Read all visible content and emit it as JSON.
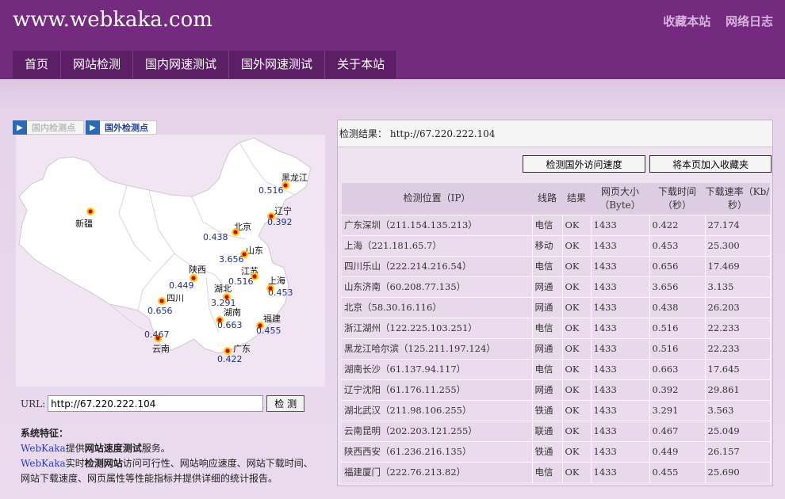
{
  "site": {
    "logo": "www.webkaka.com",
    "top_links": [
      "收藏本站",
      "网络日志"
    ],
    "nav": [
      "首页",
      "网站检测",
      "国内网速测试",
      "国外网速测试",
      "关于本站"
    ]
  },
  "map": {
    "tabs": [
      "国内检测点",
      "国外检测点"
    ],
    "points": [
      {
        "name": "黑龙江",
        "value": "0.516"
      },
      {
        "name": "新疆",
        "value": ""
      },
      {
        "name": "辽宁",
        "value": "0.392"
      },
      {
        "name": "北京",
        "value": "0.438"
      },
      {
        "name": "山东",
        "value": "3.656"
      },
      {
        "name": "江苏",
        "value": "0.516"
      },
      {
        "name": "陕西",
        "value": "0.449"
      },
      {
        "name": "上海",
        "value": "0.453"
      },
      {
        "name": "湖北",
        "value": "3.291"
      },
      {
        "name": "四川",
        "value": "0.656"
      },
      {
        "name": "湖南",
        "value": "0.663"
      },
      {
        "name": "福建",
        "value": "0.455"
      },
      {
        "name": "云南",
        "value": "0.467"
      },
      {
        "name": "广东",
        "value": "0.422"
      }
    ]
  },
  "form": {
    "url_label": "URL:",
    "url_value": "http://67.220.222.104",
    "check_button": "检 测"
  },
  "features": {
    "title": "系统特征：",
    "line1_brand": "WebKaka",
    "line1_pre": "提供",
    "line1_bold": "网站速度测试",
    "line1_post": "服务。",
    "line2_brand": "WebKaka",
    "line2_pre": "实时",
    "line2_bold": "检测网站",
    "line2_post": "访问可行性、网站响应速度、网站下载时间、网站下载速度、网页属性等性能指标并提供详细的统计报告。"
  },
  "results": {
    "label": "检测结果：",
    "url": "http://67.220.222.104",
    "button_foreign": "检测国外访问速度",
    "button_bookmark": "将本页加入收藏夹",
    "columns": [
      "检测位置（IP）",
      "线路",
      "结果",
      "网页大小（Byte）",
      "下载时间（秒）",
      "下载速率（Kb/秒）"
    ],
    "rows": [
      {
        "location": "广东深圳（211.154.135.213）",
        "line": "电信",
        "result": "OK",
        "size": "1433",
        "time": "0.422",
        "rate": "27.174"
      },
      {
        "location": "上海（221.181.65.7）",
        "line": "移动",
        "result": "OK",
        "size": "1433",
        "time": "0.453",
        "rate": "25.300"
      },
      {
        "location": "四川乐山（222.214.216.54）",
        "line": "电信",
        "result": "OK",
        "size": "1433",
        "time": "0.656",
        "rate": "17.469"
      },
      {
        "location": "山东济南（60.208.77.135）",
        "line": "网通",
        "result": "OK",
        "size": "1433",
        "time": "3.656",
        "rate": "3.135"
      },
      {
        "location": "北京（58.30.16.116）",
        "line": "网通",
        "result": "OK",
        "size": "1433",
        "time": "0.438",
        "rate": "26.203"
      },
      {
        "location": "浙江湖州（122.225.103.251）",
        "line": "电信",
        "result": "OK",
        "size": "1433",
        "time": "0.516",
        "rate": "22.233"
      },
      {
        "location": "黑龙江哈尔滨（125.211.197.124）",
        "line": "网通",
        "result": "OK",
        "size": "1433",
        "time": "0.516",
        "rate": "22.233"
      },
      {
        "location": "湖南长沙（61.137.94.117）",
        "line": "电信",
        "result": "OK",
        "size": "1433",
        "time": "0.663",
        "rate": "17.645"
      },
      {
        "location": "辽宁沈阳（61.176.11.255）",
        "line": "网通",
        "result": "OK",
        "size": "1433",
        "time": "0.392",
        "rate": "29.861"
      },
      {
        "location": "湖北武汉（211.98.106.255）",
        "line": "铁通",
        "result": "OK",
        "size": "1433",
        "time": "3.291",
        "rate": "3.563"
      },
      {
        "location": "云南昆明（202.203.121.255）",
        "line": "联通",
        "result": "OK",
        "size": "1433",
        "time": "0.467",
        "rate": "25.049"
      },
      {
        "location": "陕西西安（61.236.216.135）",
        "line": "铁通",
        "result": "OK",
        "size": "1433",
        "time": "0.449",
        "rate": "26.157"
      },
      {
        "location": "福建厦门（222.76.213.82）",
        "line": "电信",
        "result": "OK",
        "size": "1433",
        "time": "0.455",
        "rate": "25.690"
      }
    ]
  }
}
